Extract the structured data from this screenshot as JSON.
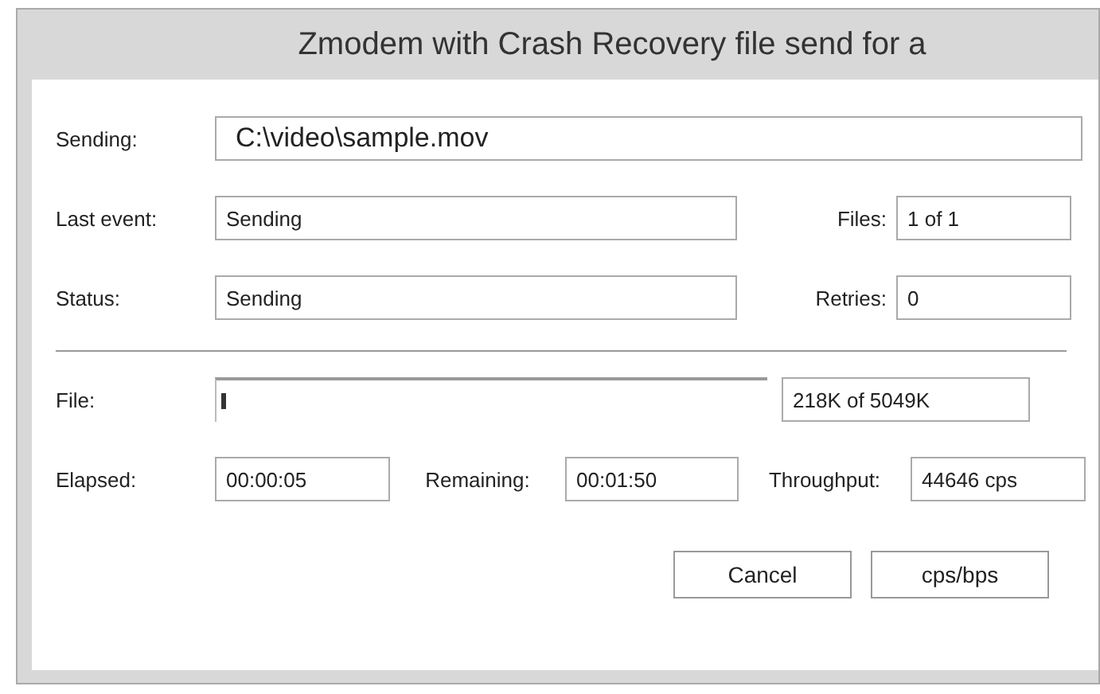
{
  "window": {
    "title": "Zmodem with Crash Recovery file send for a"
  },
  "sending": {
    "label": "Sending:",
    "value": "C:\\video\\sample.mov"
  },
  "last_event": {
    "label": "Last event:",
    "value": "Sending"
  },
  "files": {
    "label": "Files:",
    "value": "1 of 1"
  },
  "status": {
    "label": "Status:",
    "value": "Sending"
  },
  "retries": {
    "label": "Retries:",
    "value": "0"
  },
  "file": {
    "label": "File:",
    "level": 0.01,
    "size": "218K of 5049K"
  },
  "elapsed": {
    "label": "Elapsed:",
    "value": "00:00:05"
  },
  "remaining": {
    "label": "Remaining:",
    "value": "00:01:50"
  },
  "throughput": {
    "label": "Throughput:",
    "value": "44646 cps"
  },
  "buttons": [
    "Cancel",
    "cps/bps"
  ]
}
